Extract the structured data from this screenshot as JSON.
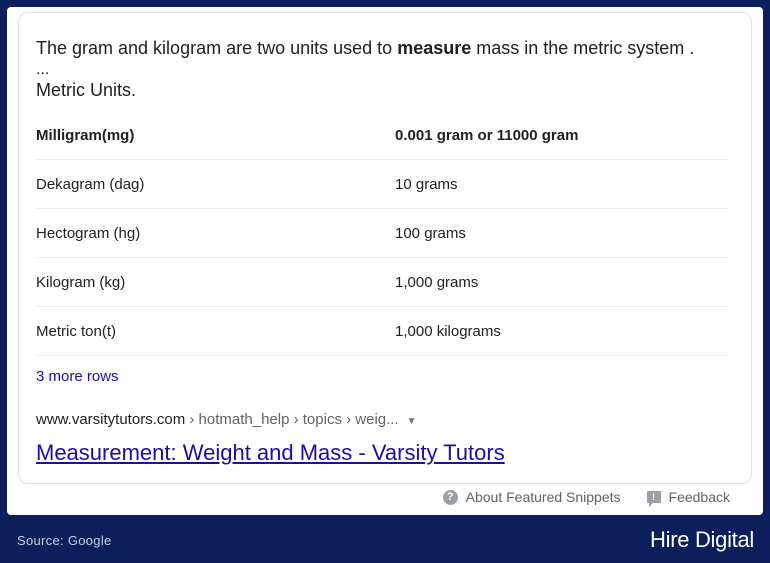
{
  "snippet": {
    "intro_before": "The gram and kilogram are two units used to ",
    "intro_bold": "measure",
    "intro_after": " mass in the metric system .",
    "ellipsis": "...",
    "units_heading": "Metric Units.",
    "table": {
      "header": [
        "Milligram(mg)",
        "0.001 gram or 11000 gram"
      ],
      "rows": [
        [
          "Dekagram (dag)",
          "10 grams"
        ],
        [
          "Hectogram (hg)",
          "100 grams"
        ],
        [
          "Kilogram (kg)",
          "1,000 grams"
        ],
        [
          "Metric ton(t)",
          "1,000 kilograms"
        ]
      ]
    },
    "more_rows": "3 more rows",
    "url_domain": "www.varsitytutors.com",
    "url_path": " › hotmath_help › topics › weig...",
    "url_caret": "▼",
    "title": "Measurement: Weight and Mass - Varsity Tutors"
  },
  "footer": {
    "about_icon": "?",
    "about": "About Featured Snippets",
    "feedback_icon": "!",
    "feedback": "Feedback"
  },
  "caption": {
    "source": "Source: Google",
    "brand": "Hire Digital"
  }
}
